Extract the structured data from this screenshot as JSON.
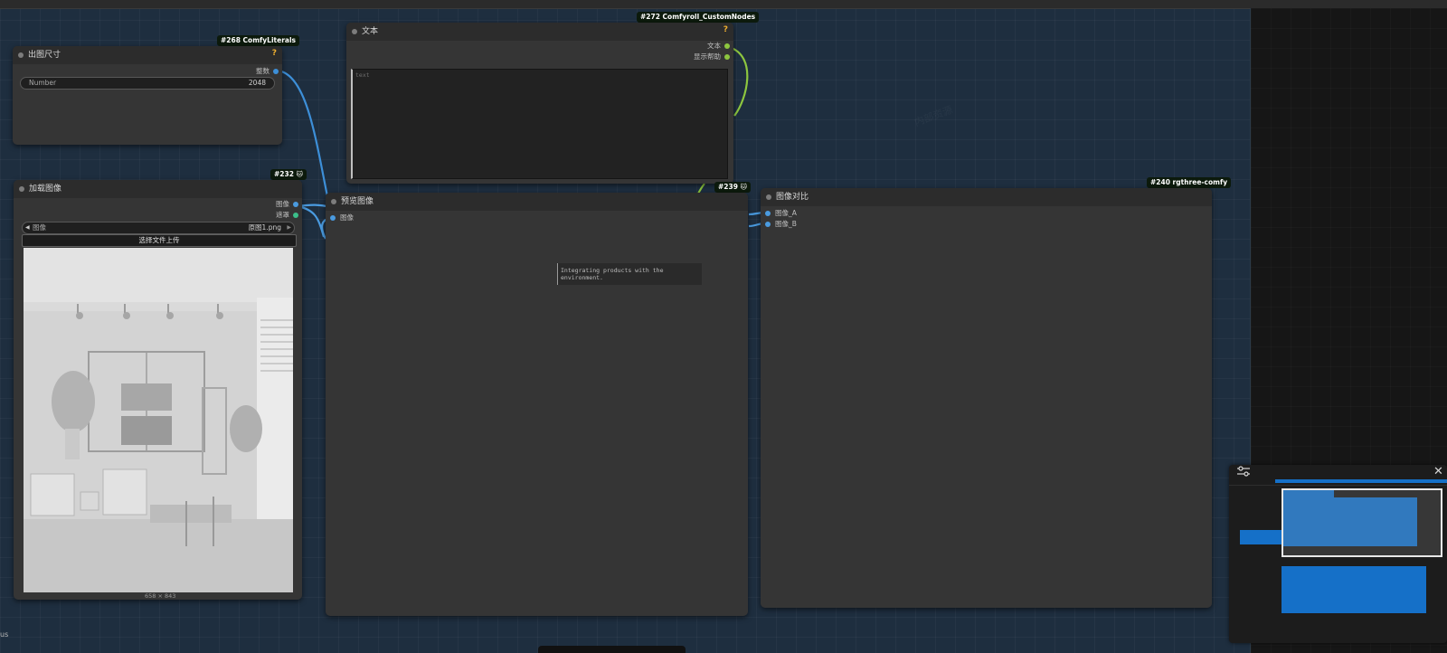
{
  "nodes": {
    "size": {
      "id_badge": "#268 ComfyLiterals",
      "title": "出图尺寸",
      "help": "?",
      "output_label": "整数",
      "widget_label": "Number",
      "widget_value": "2048"
    },
    "text": {
      "id_badge": "#272 Comfyroll_CustomNodes",
      "title": "文本",
      "help": "?",
      "output_text": "文本",
      "output_help": "显示帮助",
      "placeholder": "text"
    },
    "load_image": {
      "id_badge": "#232",
      "badge_icon": "🐱",
      "title": "加载图像",
      "output_image": "图像",
      "output_mask": "遮罩",
      "combo_label": "图像",
      "combo_value": "原图1.png",
      "upload_label": "选择文件上传",
      "image_size": "658 × 843"
    },
    "preview": {
      "id_badge": "#239",
      "badge_icon": "🐱",
      "title": "预览图像",
      "input_image": "图像",
      "tooltip": "Integrating products with the environment."
    },
    "compare": {
      "id_badge": "#240 rgthree-comfy",
      "title": "图像对比",
      "input_a": "图像_A",
      "input_b": "图像_B"
    }
  },
  "edge_text": "us",
  "minimap": {
    "settings_icon": "sliders-icon",
    "close_icon": "close-icon",
    "close_glyph": "✕"
  },
  "colors": {
    "image_wire": "#4a9be0",
    "string_wire": "#8dc63f",
    "int_wire": "#3d8fd8",
    "minimap_fill": "#1570c8"
  }
}
